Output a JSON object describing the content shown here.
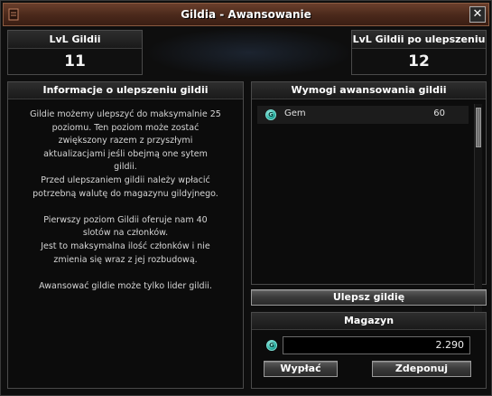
{
  "window": {
    "title": "Gildia - Awansowanie",
    "close_glyph": "✕"
  },
  "level_current": {
    "label": "LvL Gildii",
    "value": "11"
  },
  "level_next": {
    "label": "LvL Gildii po ulepszeniu",
    "value": "12"
  },
  "info": {
    "heading": "Informacje o ulepszeniu gildii",
    "paragraphs": [
      "Gildie możemy ulepszyć do maksymalnie 25\npoziomu. Ten poziom może zostać\nzwiększony razem z przyszłymi\naktualizacjami jeśli obejmą one sytem\ngildii.\nPrzed ulepszaniem gildii należy wpłacić\npotrzebną walutę do magazynu gildyjnego.",
      "Pierwszy poziom Gildii oferuje nam 40\nslotów na członków.\nJest to maksymalna ilość członków i nie\nzmienia się wraz z jej rozbudową.",
      "Awansować gildie może tylko lider gildii."
    ]
  },
  "requirements": {
    "heading": "Wymogi awansowania gildii",
    "items": [
      {
        "icon": "gem-icon",
        "icon_letter": "G",
        "name": "Gem",
        "amount": "60"
      }
    ]
  },
  "upgrade_button": "Ulepsz gildię",
  "storage": {
    "heading": "Magazyn",
    "icon": "gem-icon",
    "icon_letter": "G",
    "value": "2.290",
    "withdraw_button": "Wypłać",
    "deposit_button": "Zdeponuj"
  },
  "colors": {
    "titlebar": "#4c2a1c",
    "gem": "#2bb5a6",
    "panel_bg": "#0c0c0c"
  }
}
